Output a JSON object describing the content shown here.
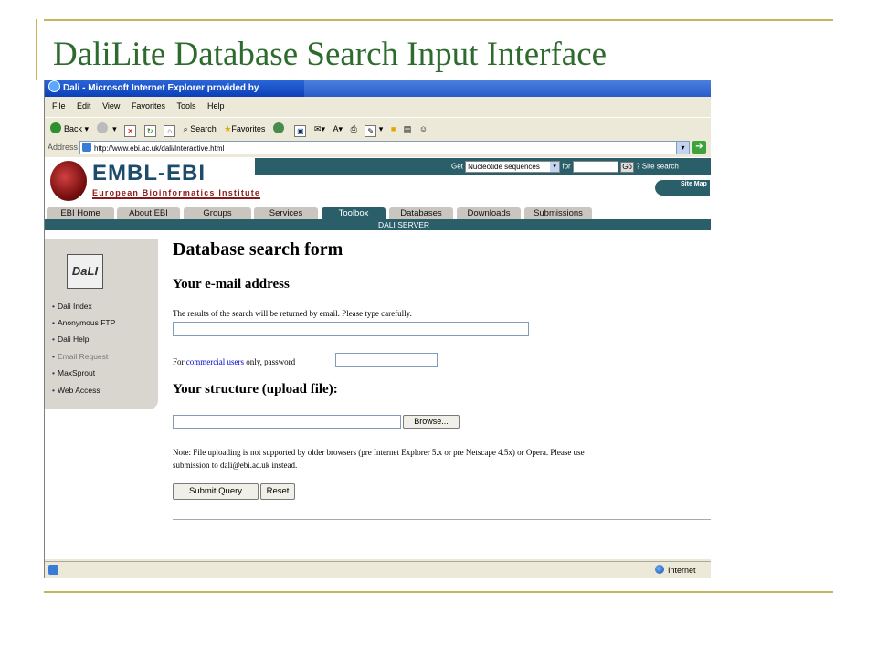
{
  "slide": {
    "title": "DaliLite Database Search Input Interface"
  },
  "browser": {
    "window_title": "Dali - Microsoft Internet Explorer provided by",
    "menu": [
      "File",
      "Edit",
      "View",
      "Favorites",
      "Tools",
      "Help"
    ],
    "toolbar": {
      "back": "Back",
      "search": "Search",
      "favorites": "Favorites"
    },
    "address_label": "Address",
    "url": "http://www.ebi.ac.uk/dali/Interactive.html",
    "status_zone": "Internet"
  },
  "ebi": {
    "logo": "EMBL-EBI",
    "subtitle": "European Bioinformatics Institute",
    "search": {
      "get_label": "Get",
      "db_selected": "Nucleotide sequences",
      "for_label": "for",
      "go_label": "Go",
      "site_search_label": "? Site search"
    },
    "site_map": "Site Map",
    "tabs": [
      "EBI Home",
      "About EBI",
      "Groups",
      "Services",
      "Toolbox",
      "Databases",
      "Downloads",
      "Submissions"
    ],
    "active_tab": "Toolbox",
    "subheader": "DALI SERVER"
  },
  "leftnav": {
    "logo_text": "DaLI",
    "items": [
      {
        "label": "Dali Index",
        "disabled": false
      },
      {
        "label": "Anonymous FTP",
        "disabled": false
      },
      {
        "label": "Dali Help",
        "disabled": false
      },
      {
        "label": "Email Request",
        "disabled": true
      },
      {
        "label": "MaxSprout",
        "disabled": false
      },
      {
        "label": "Web Access",
        "disabled": false
      }
    ]
  },
  "form": {
    "heading": "Database search form",
    "email_heading": "Your e-mail address",
    "email_help": "The results of the search will be returned by email. Please type carefully.",
    "email_value": "",
    "password_prefix": "For ",
    "password_link": "commercial users",
    "password_suffix": " only, password",
    "password_value": "",
    "structure_heading": "Your structure (upload file):",
    "file_value": "",
    "browse_label": "Browse...",
    "note_line1": "Note: File uploading is not supported by older browsers (pre Internet Explorer 5.x or pre Netscape 4.5x) or Opera. Please use",
    "note_line2": "submission to dali@ebi.ac.uk instead.",
    "submit_label": "Submit Query",
    "reset_label": "Reset"
  }
}
